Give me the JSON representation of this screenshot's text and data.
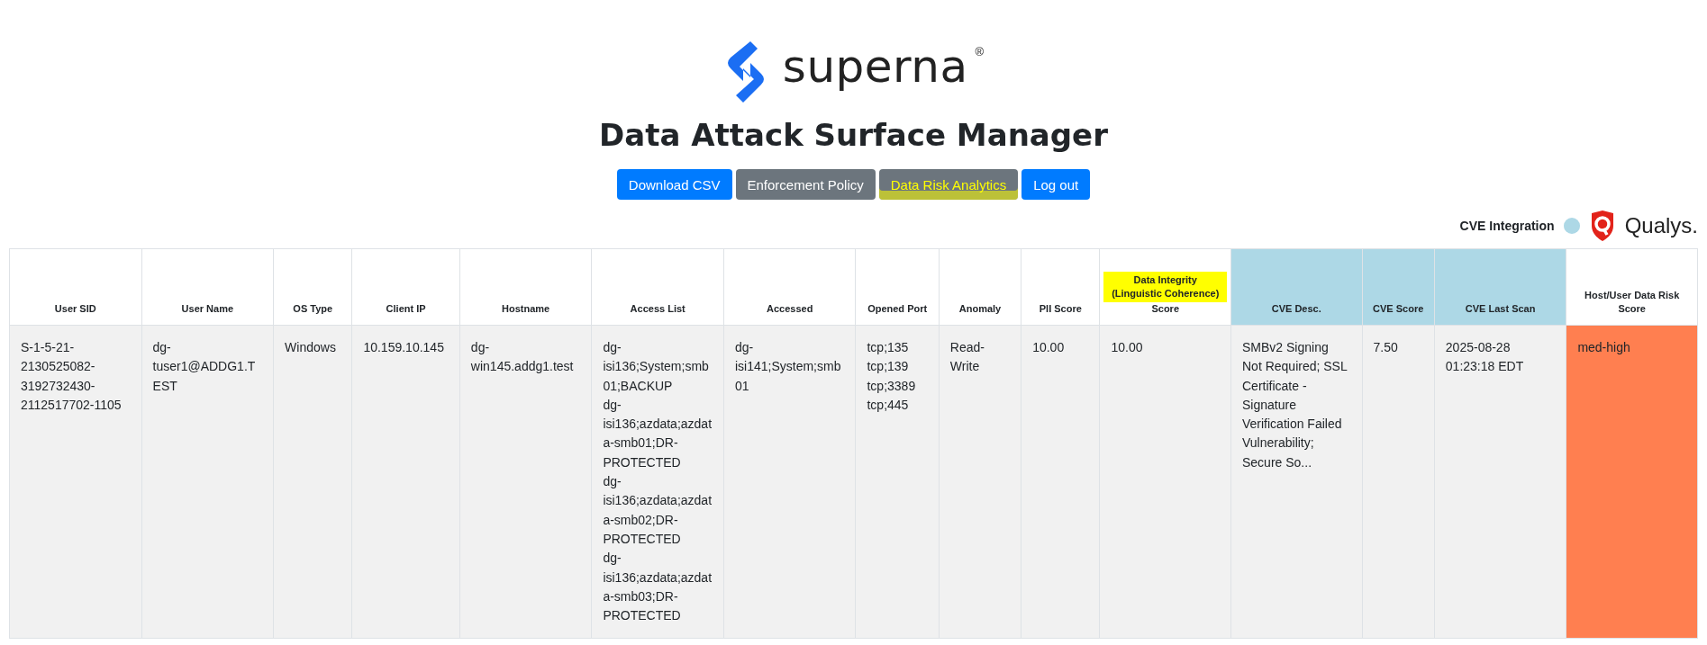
{
  "brand": {
    "name": "superna",
    "mark": "®"
  },
  "title": "Data Attack Surface Manager",
  "buttons": [
    {
      "label": "Download CSV",
      "kind": "primary",
      "highlighted": false
    },
    {
      "label": "Enforcement Policy",
      "kind": "secondary",
      "highlighted": false
    },
    {
      "label": "Data Risk Analytics",
      "kind": "secondary",
      "highlighted": true
    },
    {
      "label": "Log out",
      "kind": "primary",
      "highlighted": false
    }
  ],
  "cve_integration": {
    "label": "CVE Integration",
    "color": "#add8e6",
    "vendor": "Qualys."
  },
  "table": {
    "columns": [
      {
        "label": "User SID",
        "kind": "plain",
        "highlighted": false
      },
      {
        "label": "User Name",
        "kind": "plain",
        "highlighted": false
      },
      {
        "label": "OS Type",
        "kind": "plain",
        "highlighted": false
      },
      {
        "label": "Client IP",
        "kind": "plain",
        "highlighted": false
      },
      {
        "label": "Hostname",
        "kind": "plain",
        "highlighted": false
      },
      {
        "label": "Access List",
        "kind": "plain",
        "highlighted": false
      },
      {
        "label": "Accessed",
        "kind": "plain",
        "highlighted": false
      },
      {
        "label": "Opened Port",
        "kind": "plain",
        "highlighted": false
      },
      {
        "label": "Anomaly",
        "kind": "plain",
        "highlighted": false
      },
      {
        "label": "PII Score",
        "kind": "plain",
        "highlighted": false
      },
      {
        "label": "Data Integrity (Linguistic Coherence)",
        "sublabel": "Score",
        "kind": "plain",
        "highlighted": true
      },
      {
        "label": "CVE Desc.",
        "kind": "cve",
        "highlighted": false
      },
      {
        "label": "CVE Score",
        "kind": "cve",
        "highlighted": false
      },
      {
        "label": "CVE Last Scan",
        "kind": "cve",
        "highlighted": false
      },
      {
        "label": "Host/User Data Risk Score",
        "kind": "plain",
        "highlighted": false
      }
    ],
    "rows": [
      {
        "color": "#ff7f50",
        "cells": [
          [
            "S-1-5-21-2130525082-3192732430-2112517702-1105"
          ],
          [
            "dg-tuser1@ADDG1.TEST"
          ],
          [
            "Windows"
          ],
          [
            "10.159.10.145"
          ],
          [
            "dg-win145.addg1.test"
          ],
          [
            "dg-isi136;System;smb01;BACKUP",
            "dg-isi136;azdata;azdata-smb01;DR-PROTECTED",
            "dg-isi136;azdata;azdata-smb02;DR-PROTECTED",
            "dg-isi136;azdata;azdata-smb03;DR-PROTECTED"
          ],
          [
            "dg-isi141;System;smb01"
          ],
          [
            "tcp;135",
            "tcp;139",
            "tcp;3389",
            "tcp;445"
          ],
          [
            "Read-Write"
          ],
          [
            "10.00"
          ],
          [
            "10.00"
          ],
          [
            "SMBv2 Signing Not Required; SSL Certificate - Signature Verification Failed Vulnerability; Secure So..."
          ],
          [
            "7.50"
          ],
          [
            "2025-08-28 01:23:18 EDT"
          ],
          [
            "med-high"
          ]
        ]
      }
    ]
  }
}
